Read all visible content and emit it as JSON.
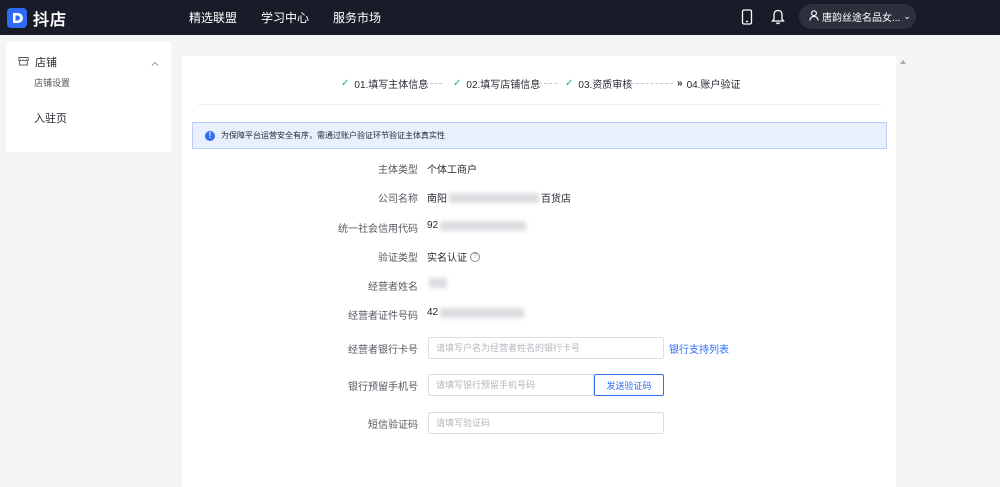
{
  "header": {
    "brand": "抖店",
    "nav": [
      {
        "label": "精选联盟"
      },
      {
        "label": "学习中心"
      },
      {
        "label": "服务市场"
      }
    ],
    "icons": [
      "mobile-icon",
      "bell-icon",
      "user-icon"
    ],
    "user_name": "唐韵丝途名品女...",
    "user_caret": "⌄"
  },
  "sidebar": {
    "group_label": "店铺",
    "sub_item": "店铺设置",
    "item2": "入驻页"
  },
  "steps": [
    {
      "label": "01.填写主体信息",
      "status": "done"
    },
    {
      "label": "02.填写店铺信息",
      "status": "done"
    },
    {
      "label": "03.资质审核",
      "status": "done"
    },
    {
      "label": "04.账户验证",
      "status": "current"
    }
  ],
  "notice": "为保障平台运营安全有序，需通过账户验证环节验证主体真实性",
  "fields": {
    "subject_type": {
      "label": "主体类型",
      "value": "个体工商户"
    },
    "company_name": {
      "label": "公司名称",
      "prefix": "南阳",
      "suffix": "百货店"
    },
    "credit_code": {
      "label": "统一社会信用代码",
      "prefix": "92"
    },
    "verify_type": {
      "label": "验证类型",
      "value": "实名认证",
      "help": "?"
    },
    "operator_name": {
      "label": "经营者姓名"
    },
    "operator_id": {
      "label": "经营者证件号码",
      "prefix": "42"
    },
    "bank_card": {
      "label": "经营者银行卡号",
      "placeholder": "请填写户名为经营者姓名的银行卡号",
      "link": "银行支持列表"
    },
    "bank_phone": {
      "label": "银行预留手机号",
      "placeholder": "请填写银行预留手机号码",
      "button": "发送验证码"
    },
    "sms_code": {
      "label": "短信验证码",
      "placeholder": "请填写验证码"
    }
  },
  "colors": {
    "topbar": "#191c28",
    "accent": "#2e6cf6",
    "success": "#17b26a",
    "notice_bg": "#e8f0fd"
  }
}
